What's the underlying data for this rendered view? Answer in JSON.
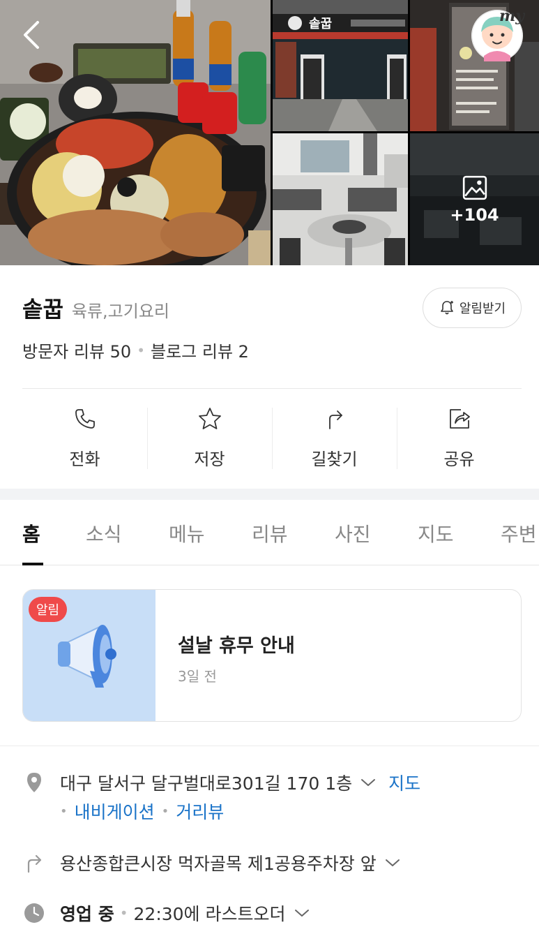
{
  "gallery": {
    "more_count": "+104",
    "store_sign": "솥꿉"
  },
  "header": {
    "my_label": "my"
  },
  "place": {
    "name": "솥꿉",
    "category": "육류,고기요리",
    "notify_label": "알림받기",
    "visitor_reviews": "방문자 리뷰 50",
    "blog_reviews": "블로그 리뷰 2"
  },
  "actions": [
    {
      "label": "전화",
      "icon": "phone-icon"
    },
    {
      "label": "저장",
      "icon": "star-icon"
    },
    {
      "label": "길찾기",
      "icon": "directions-icon"
    },
    {
      "label": "공유",
      "icon": "share-icon"
    }
  ],
  "tabs": [
    {
      "label": "홈",
      "active": true
    },
    {
      "label": "소식"
    },
    {
      "label": "메뉴"
    },
    {
      "label": "리뷰"
    },
    {
      "label": "사진"
    },
    {
      "label": "지도"
    },
    {
      "label": "주변"
    }
  ],
  "notice": {
    "badge": "알림",
    "title": "설날 휴무 안내",
    "time": "3일 전"
  },
  "info": {
    "address": "대구 달서구 달구벌대로301길 170 1층",
    "map_link": "지도",
    "navigation_link": "내비게이션",
    "streetview_link": "거리뷰",
    "directions_text": "용산종합큰시장 먹자골목 제1공용주차장 앞",
    "status": "영업 중",
    "last_order": "22:30에 라스트오더"
  },
  "colors": {
    "accent_link": "#1a73c8",
    "badge_red": "#ef4a4a",
    "notice_bg": "#c8def7"
  }
}
